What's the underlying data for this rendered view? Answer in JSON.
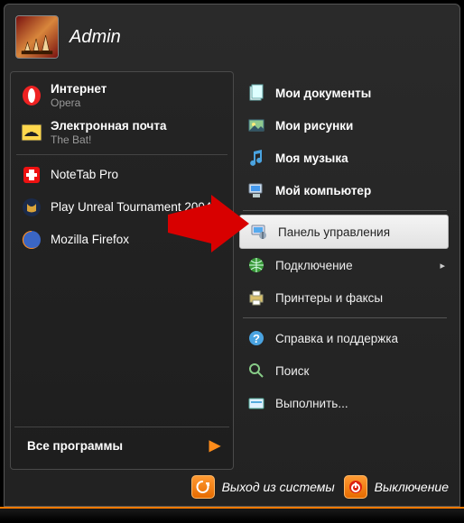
{
  "user": {
    "name": "Admin"
  },
  "pinned": [
    {
      "id": "internet",
      "title": "Интернет",
      "sub": "Opera"
    },
    {
      "id": "mail",
      "title": "Электронная почта",
      "sub": "The Bat!"
    },
    {
      "id": "notetab",
      "title": "NoteTab Pro",
      "sub": ""
    },
    {
      "id": "ut2004",
      "title": "Play Unreal Tournament 2004",
      "sub": ""
    },
    {
      "id": "firefox",
      "title": "Mozilla Firefox",
      "sub": ""
    }
  ],
  "all_programs_label": "Все программы",
  "right": {
    "docs": "Мои документы",
    "pics": "Мои рисунки",
    "music": "Моя музыка",
    "computer": "Мой компьютер",
    "control_panel": "Панель управления",
    "connect": "Подключение",
    "printers": "Принтеры и факсы",
    "help": "Справка и поддержка",
    "search": "Поиск",
    "run": "Выполнить..."
  },
  "footer": {
    "logoff": "Выход из системы",
    "shutdown": "Выключение"
  }
}
